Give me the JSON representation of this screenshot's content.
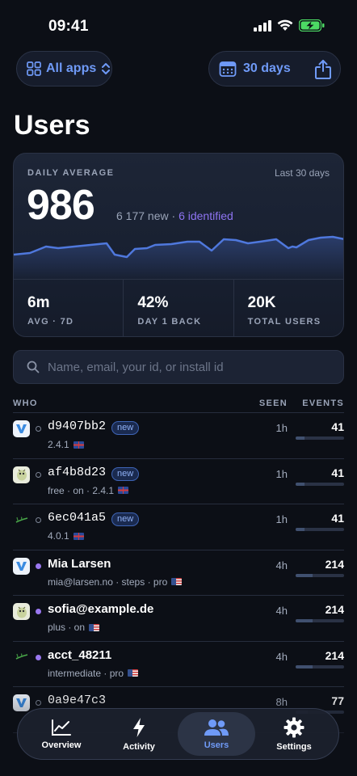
{
  "status_bar": {
    "time": "09:41"
  },
  "controls": {
    "apps_label": "All apps",
    "range_label": "30 days"
  },
  "page": {
    "title": "Users"
  },
  "summary": {
    "label": "DAILY AVERAGE",
    "range": "Last 30 days",
    "value": "986",
    "new_text": "6 177 new · ",
    "identified_text": "6 identified",
    "stats": [
      {
        "value": "6m",
        "label": "AVG · 7D"
      },
      {
        "value": "42%",
        "label": "DAY 1 BACK"
      },
      {
        "value": "20K",
        "label": "TOTAL USERS"
      }
    ]
  },
  "search": {
    "placeholder": "Name, email, your id, or install id"
  },
  "table": {
    "headers": {
      "who": "WHO",
      "seen": "SEEN",
      "events": "EVENTS"
    },
    "rows": [
      {
        "name": "d9407bb2",
        "badge": "new",
        "meta": "2.4.1",
        "flag": "uk",
        "seen": "1h",
        "events": "41",
        "events_fraction": 0.19,
        "avatar": "v",
        "dot": "hollow",
        "mono": true
      },
      {
        "name": "af4b8d23",
        "badge": "new",
        "meta": "free · on · 2.4.1",
        "flag": "uk",
        "seen": "1h",
        "events": "41",
        "events_fraction": 0.19,
        "avatar": "bug",
        "dot": "hollow",
        "mono": true
      },
      {
        "name": "6ec041a5",
        "badge": "new",
        "meta": "4.0.1",
        "flag": "uk",
        "seen": "1h",
        "events": "41",
        "events_fraction": 0.19,
        "avatar": "dark",
        "dot": "hollow",
        "mono": true
      },
      {
        "name": "Mia Larsen",
        "badge": "",
        "meta": "mia@larsen.no · steps · pro",
        "flag": "us",
        "seen": "4h",
        "events": "214",
        "events_fraction": 0.35,
        "avatar": "v",
        "dot": "filled",
        "mono": false
      },
      {
        "name": "sofia@example.de",
        "badge": "",
        "meta": "plus · on",
        "flag": "us",
        "seen": "4h",
        "events": "214",
        "events_fraction": 0.35,
        "avatar": "bug",
        "dot": "filled",
        "mono": false
      },
      {
        "name": "acct_48211",
        "badge": "",
        "meta": "intermediate · pro",
        "flag": "us",
        "seen": "4h",
        "events": "214",
        "events_fraction": 0.35,
        "avatar": "dark",
        "dot": "filled",
        "mono": false
      },
      {
        "name": "0a9e47c3",
        "badge": "",
        "meta": "",
        "flag": "",
        "seen": "8h",
        "events": "77",
        "events_fraction": 0.25,
        "avatar": "v",
        "dot": "hollow",
        "mono": true
      }
    ]
  },
  "tab_bar": {
    "tabs": [
      {
        "label": "Overview",
        "icon": "chart-line-icon"
      },
      {
        "label": "Activity",
        "icon": "bolt-icon"
      },
      {
        "label": "Users",
        "icon": "users-icon"
      },
      {
        "label": "Settings",
        "icon": "gear-icon"
      }
    ],
    "active": "Users"
  },
  "colors": {
    "accent": "#6f9af7",
    "identified": "#8e74f2",
    "background": "#0c0f16"
  }
}
